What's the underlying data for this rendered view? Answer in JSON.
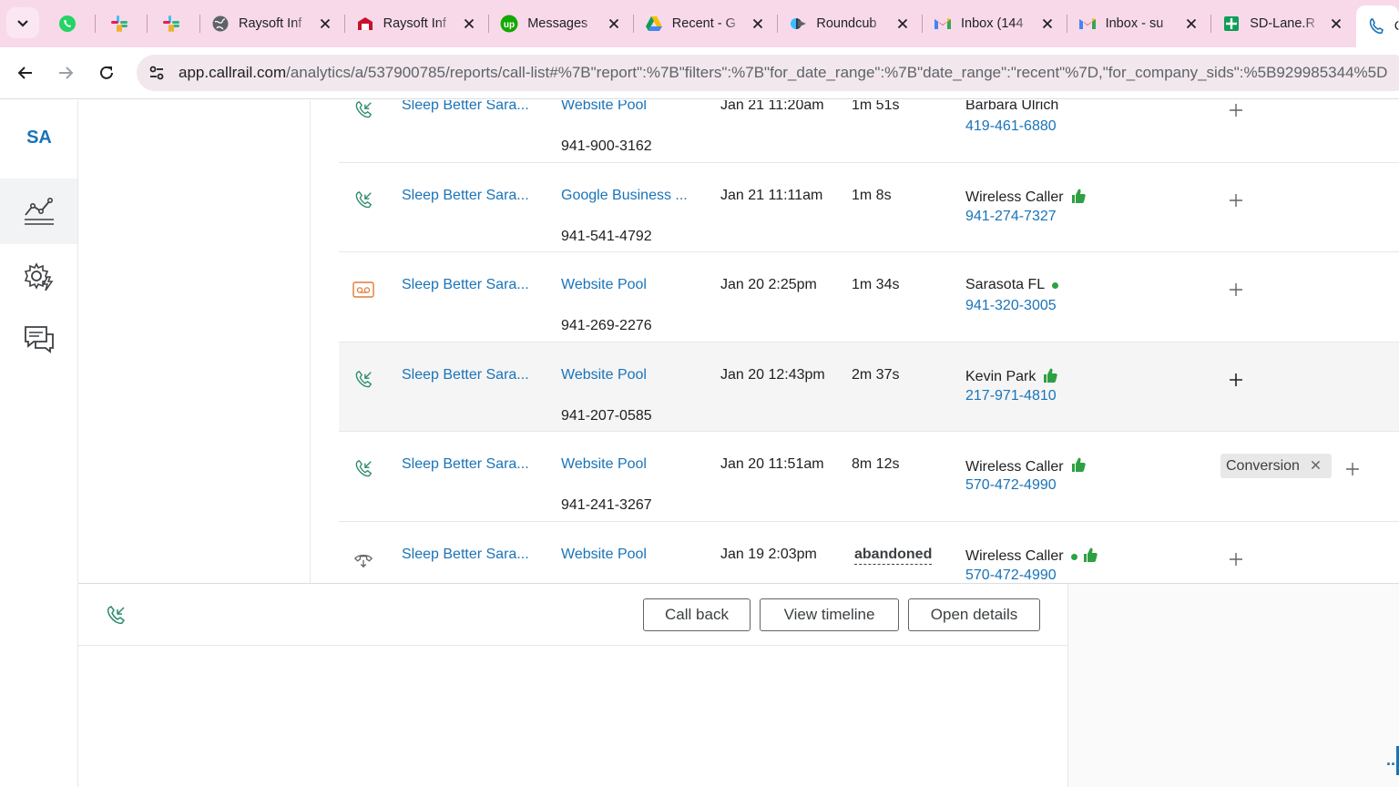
{
  "browser": {
    "tabs": [
      {
        "title": "",
        "icon": "whatsapp-icon"
      },
      {
        "title": "",
        "icon": "slack-icon"
      },
      {
        "title": "",
        "icon": "slack-icon"
      },
      {
        "title": "Raysoft Inf",
        "icon": "globe-icon"
      },
      {
        "title": "Raysoft Inf",
        "icon": "raysoft-icon"
      },
      {
        "title": "Messages",
        "icon": "upwork-icon"
      },
      {
        "title": "Recent - G",
        "icon": "drive-icon"
      },
      {
        "title": "Roundcub",
        "icon": "roundcube-icon"
      },
      {
        "title": "Inbox (144",
        "icon": "gmail-icon"
      },
      {
        "title": "Inbox - su",
        "icon": "gmail-icon"
      },
      {
        "title": "SD-Lane.R",
        "icon": "sheets-icon"
      },
      {
        "title": "C",
        "icon": "phone-icon"
      }
    ],
    "url_host": "app.callrail.com",
    "url_path": "/analytics/a/537900785/reports/call-list#%7B\"report\":%7B\"filters\":%7B\"for_date_range\":%7B\"date_range\":\"recent\"%7D,\"for_company_sids\":%5B929985344%5D"
  },
  "sidebar": {
    "avatar": "SA",
    "items": [
      {
        "name": "analytics",
        "icon": "chart-line-icon",
        "active": true
      },
      {
        "name": "settings",
        "icon": "gear-bolt-icon",
        "active": false
      },
      {
        "name": "messages",
        "icon": "chat-bubbles-icon",
        "active": false
      }
    ]
  },
  "calls": [
    {
      "type": "inbound",
      "company": "Sleep Better Sara...",
      "source": "Website Pool",
      "tracking": "941-900-3162",
      "time": "Jan 21 11:20am",
      "duration": "1m 51s",
      "caller": "Barbara Ulrich",
      "phone": "419-461-6880",
      "badge": "",
      "tag": ""
    },
    {
      "type": "inbound",
      "company": "Sleep Better Sara...",
      "source": "Google Business ...",
      "tracking": "941-541-4792",
      "time": "Jan 21 11:11am",
      "duration": "1m 8s",
      "caller": "Wireless Caller",
      "phone": "941-274-7327",
      "badge": "thumb",
      "tag": ""
    },
    {
      "type": "voicemail",
      "company": "Sleep Better Sara...",
      "source": "Website Pool",
      "tracking": "941-269-2276",
      "time": "Jan 20 2:25pm",
      "duration": "1m 34s",
      "caller": "Sarasota FL",
      "phone": "941-320-3005",
      "badge": "dot",
      "tag": ""
    },
    {
      "type": "inbound",
      "company": "Sleep Better Sara...",
      "source": "Website Pool",
      "tracking": "941-207-0585",
      "time": "Jan 20 12:43pm",
      "duration": "2m 37s",
      "caller": "Kevin Park",
      "phone": "217-971-4810",
      "badge": "thumb",
      "tag": ""
    },
    {
      "type": "inbound",
      "company": "Sleep Better Sara...",
      "source": "Website Pool",
      "tracking": "941-241-3267",
      "time": "Jan 20 11:51am",
      "duration": "8m 12s",
      "caller": "Wireless Caller",
      "phone": "570-472-4990",
      "badge": "thumb",
      "tag": "Conversion"
    },
    {
      "type": "abandoned",
      "company": "Sleep Better Sara...",
      "source": "Website Pool",
      "tracking": "",
      "time": "Jan 19 2:03pm",
      "duration": "abandoned",
      "caller": "Wireless Caller",
      "phone": "570-472-4990",
      "badge": "dot-thumb",
      "tag": ""
    }
  ],
  "detail": {
    "call_back": "Call back",
    "view_timeline": "View timeline",
    "open_details": "Open details",
    "dots": ".."
  },
  "colors": {
    "link": "#1a73b8",
    "thumb": "#2ea043",
    "tabbar": "#f8d9ea"
  }
}
